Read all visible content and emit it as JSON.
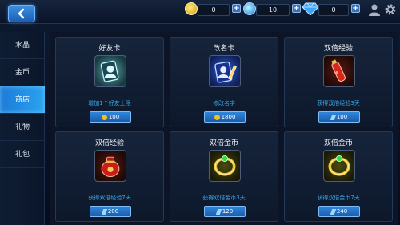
{
  "resources": [
    {
      "name": "gold",
      "value": "0"
    },
    {
      "name": "exp-orb",
      "value": "10"
    },
    {
      "name": "diamond",
      "value": "0"
    }
  ],
  "sidebar": {
    "items": [
      {
        "label": "水晶"
      },
      {
        "label": "金币"
      },
      {
        "label": "商店"
      },
      {
        "label": "礼物"
      },
      {
        "label": "礼包"
      }
    ]
  },
  "shop": {
    "items": [
      {
        "title": "好友卡",
        "desc": "增加1个好友上限",
        "price": "100",
        "currency": "gold",
        "icon": "friend-card-icon"
      },
      {
        "title": "改名卡",
        "desc": "修改名字",
        "price": "1800",
        "currency": "gold",
        "icon": "rename-card-icon"
      },
      {
        "title": "双倍经验",
        "desc": "获得双倍经验3天",
        "price": "100",
        "currency": "gem",
        "icon": "red-potion-icon"
      },
      {
        "title": "双倍经验",
        "desc": "获得双倍经验7天",
        "price": "200",
        "currency": "gem",
        "icon": "red-pouch-icon"
      },
      {
        "title": "双倍金币",
        "desc": "获得双倍金币3天",
        "price": "120",
        "currency": "gem",
        "icon": "green-ring-icon"
      },
      {
        "title": "双倍金币",
        "desc": "获得双倍金币7天",
        "price": "240",
        "currency": "gem",
        "icon": "green-ring-icon"
      }
    ]
  },
  "colors": {
    "accent": "#2aa4f0",
    "gold": "#f0c020",
    "desc": "#3aa6e6"
  }
}
